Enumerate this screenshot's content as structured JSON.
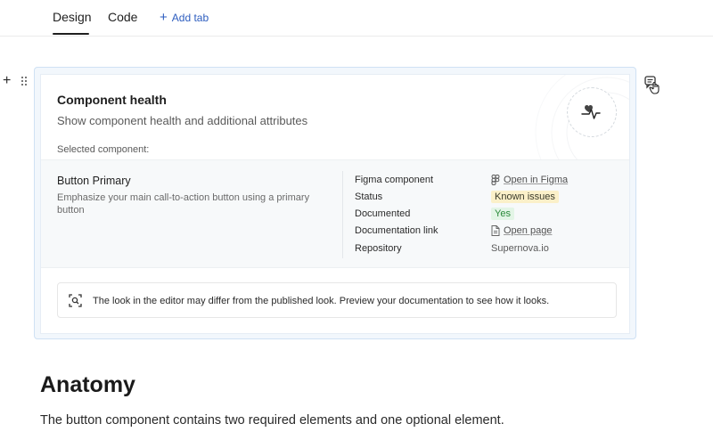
{
  "tabs": {
    "items": [
      {
        "label": "Design",
        "active": true
      },
      {
        "label": "Code",
        "active": false
      }
    ],
    "add_tab_label": "Add tab"
  },
  "block_controls": {
    "add_icon": "plus-icon",
    "drag_icon": "drag-handle-icon",
    "comment_icon": "comment-icon"
  },
  "health_card": {
    "title": "Component health",
    "subtitle": "Show component health and additional attributes",
    "selected_label": "Selected component:",
    "icon": "pulse-heart-icon",
    "component": {
      "name": "Button Primary",
      "description": "Emphasize your main call-to-action button using a primary button"
    },
    "attributes": [
      {
        "key": "Figma component",
        "value": "Open in Figma",
        "type": "link",
        "icon": "figma-icon"
      },
      {
        "key": "Status",
        "value": "Known issues",
        "type": "badge-warning"
      },
      {
        "key": "Documented",
        "value": "Yes",
        "type": "badge-success"
      },
      {
        "key": "Documentation link",
        "value": "Open page",
        "type": "link",
        "icon": "document-icon"
      },
      {
        "key": "Repository",
        "value": "Supernova.io",
        "type": "text"
      }
    ],
    "notice": {
      "icon": "preview-icon",
      "text": "The look in the editor may differ from the published look. Preview your documentation to see how it looks."
    }
  },
  "anatomy": {
    "title": "Anatomy",
    "text": "The button component contains two required elements and one optional element."
  },
  "colors": {
    "accent": "#2d5dbf",
    "card_border": "#cfe1f4",
    "warning_badge": "#fbf0c9",
    "success_badge": "#e3f5e6",
    "success_text": "#2a8a3a"
  }
}
